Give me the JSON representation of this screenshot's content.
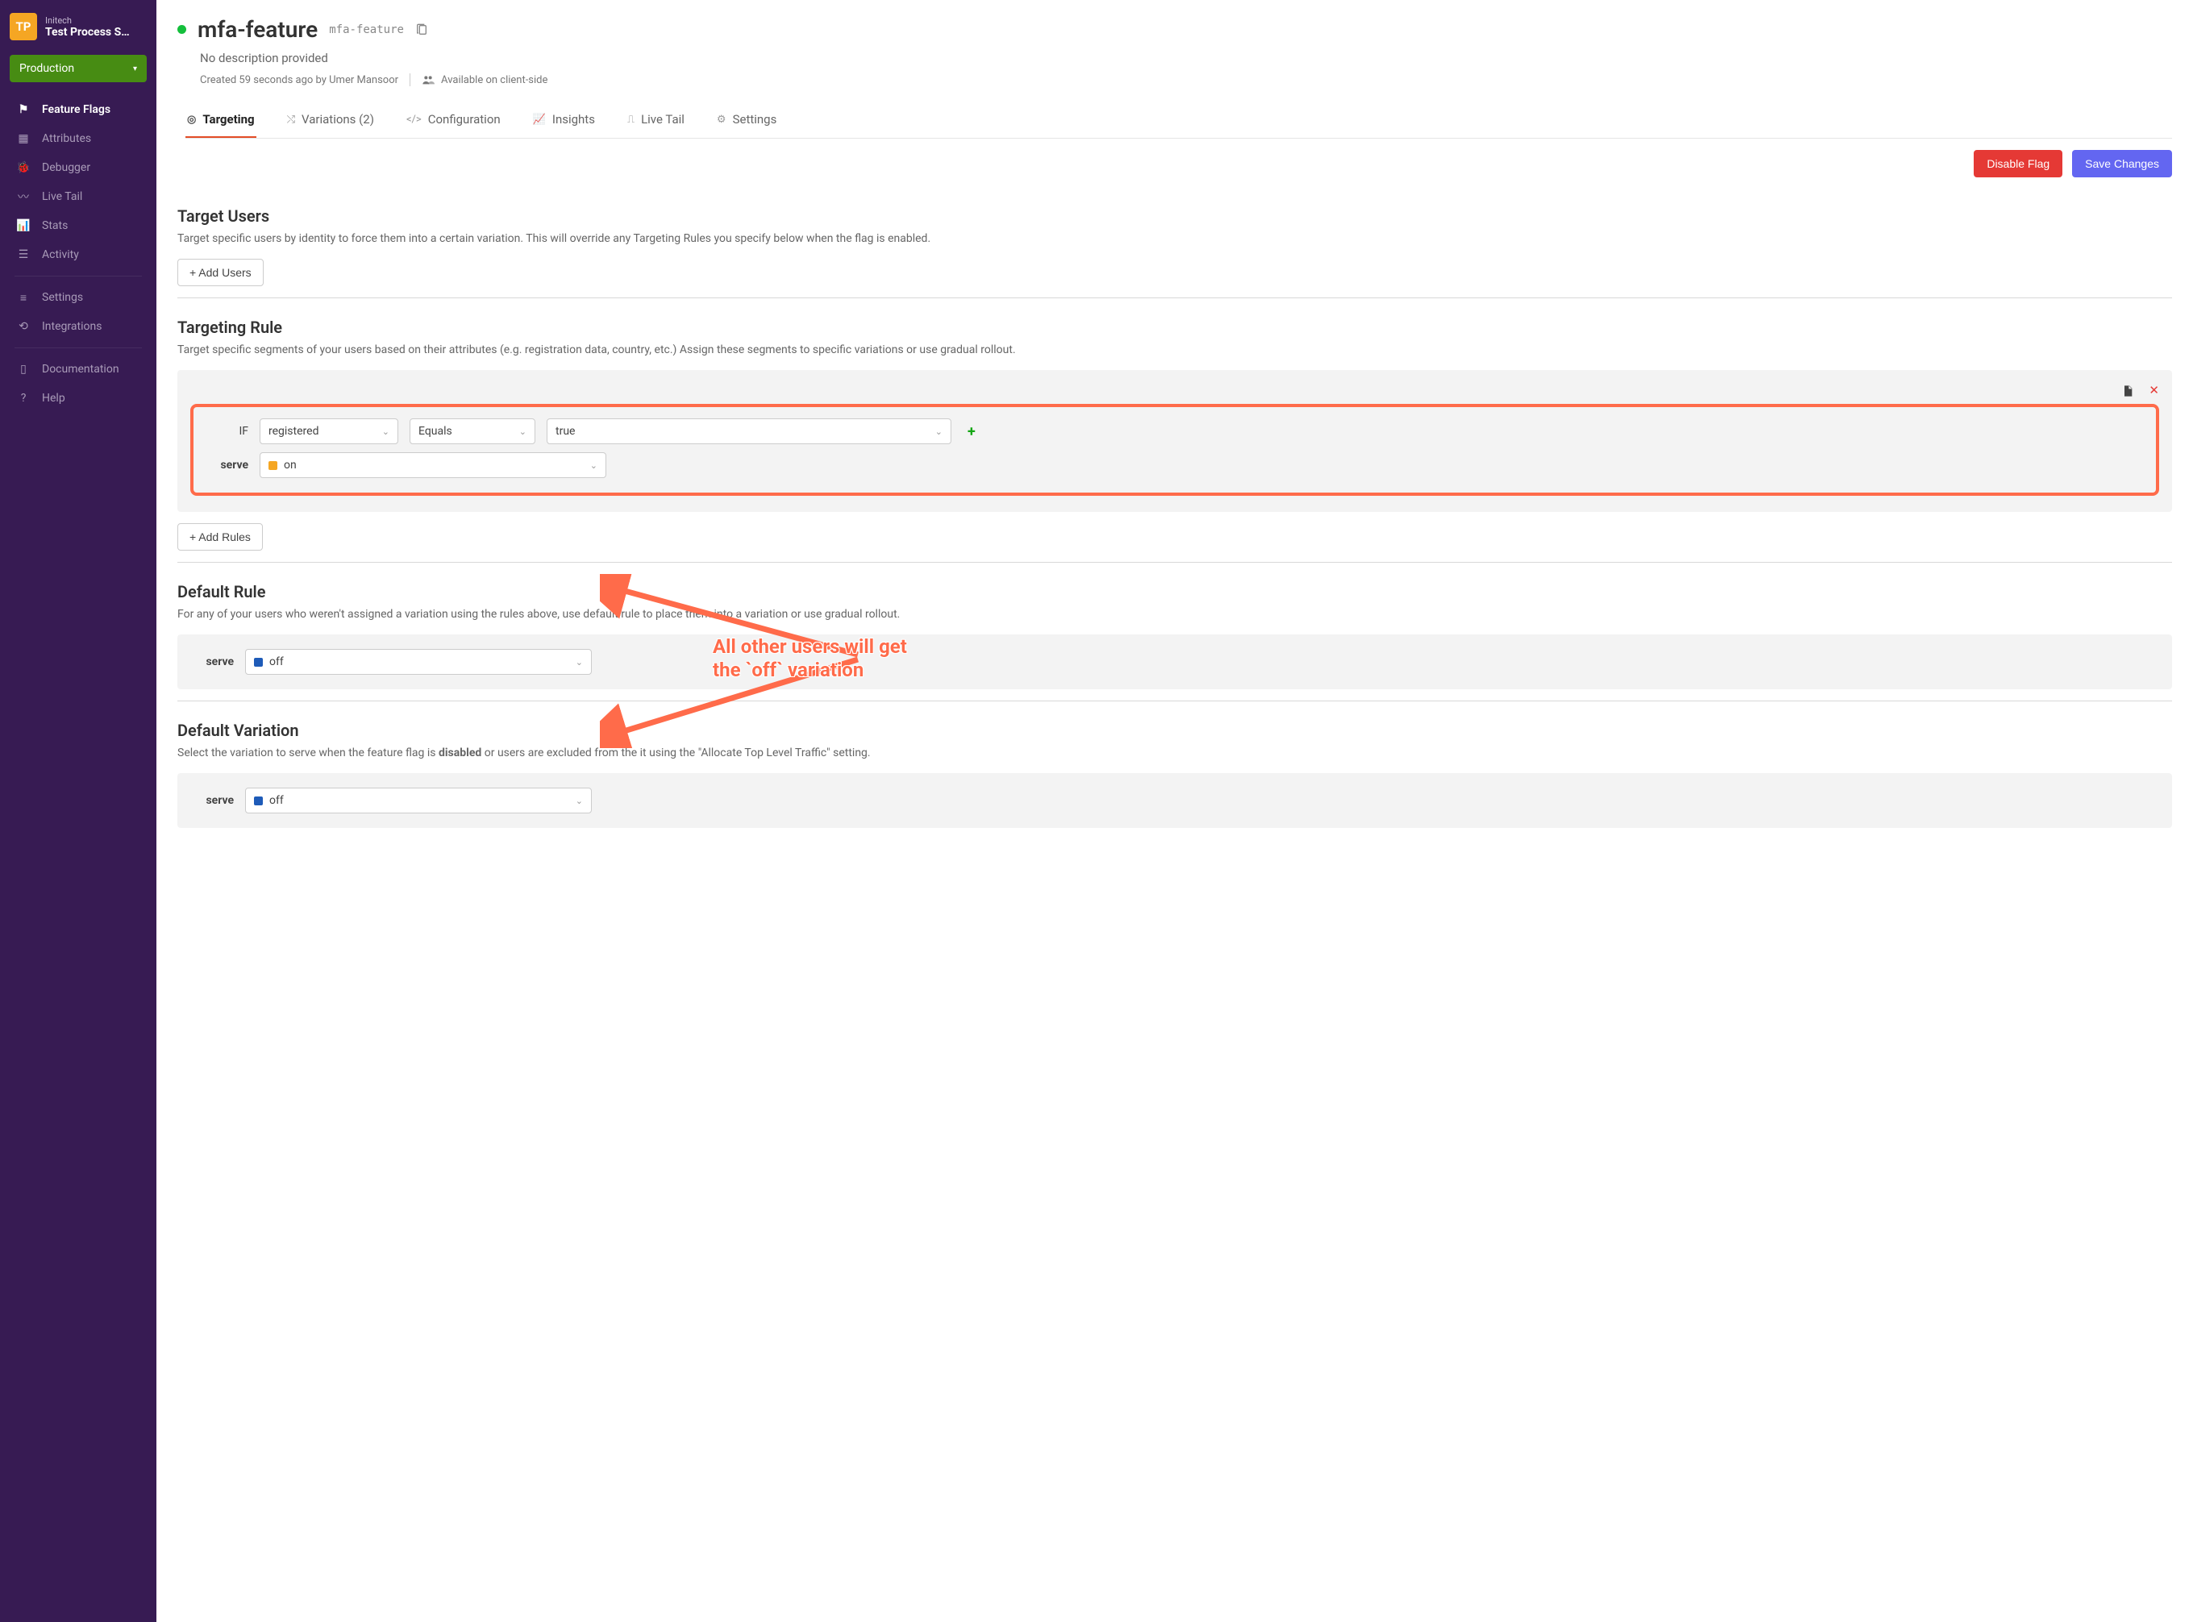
{
  "org": {
    "avatar": "TP",
    "name": "Initech",
    "project": "Test Process S…"
  },
  "environment": "Production",
  "sidebar": {
    "items": [
      {
        "icon": "flag",
        "label": "Feature Flags",
        "active": true
      },
      {
        "icon": "attrs",
        "label": "Attributes"
      },
      {
        "icon": "bug",
        "label": "Debugger"
      },
      {
        "icon": "wave",
        "label": "Live Tail"
      },
      {
        "icon": "stats",
        "label": "Stats"
      },
      {
        "icon": "list",
        "label": "Activity"
      }
    ],
    "secondary": [
      {
        "icon": "sliders",
        "label": "Settings"
      },
      {
        "icon": "plug",
        "label": "Integrations"
      }
    ],
    "footer": [
      {
        "icon": "book",
        "label": "Documentation"
      },
      {
        "icon": "help",
        "label": "Help"
      }
    ]
  },
  "flag": {
    "title": "mfa-feature",
    "key": "mfa-feature",
    "description": "No description provided",
    "created": "Created 59 seconds ago by Umer Mansoor",
    "availability": "Available on client-side"
  },
  "tabs": [
    {
      "icon": "target",
      "label": "Targeting",
      "active": true
    },
    {
      "icon": "shuffle",
      "label": "Variations (2)"
    },
    {
      "icon": "code",
      "label": "Configuration"
    },
    {
      "icon": "chart",
      "label": "Insights"
    },
    {
      "icon": "signal",
      "label": "Live Tail"
    },
    {
      "icon": "gear",
      "label": "Settings"
    }
  ],
  "actions": {
    "disable": "Disable Flag",
    "save": "Save Changes"
  },
  "sections": {
    "target_users": {
      "title": "Target Users",
      "desc": "Target specific users by identity to force them into a certain variation. This will override any Targeting Rules you specify below when the flag is enabled.",
      "add_btn": "+ Add Users"
    },
    "targeting_rule": {
      "title": "Targeting Rule",
      "desc": "Target specific segments of your users based on their attributes (e.g. registration data, country, etc.) Assign these segments to specific variations or use gradual rollout.",
      "if_label": "IF",
      "serve_label": "serve",
      "attr": "registered",
      "op": "Equals",
      "val": "true",
      "serve": "on",
      "add_btn": "+ Add Rules"
    },
    "default_rule": {
      "title": "Default Rule",
      "desc": "For any of your users who weren't assigned a variation using the rules above, use default rule to place them into a variation or use gradual rollout.",
      "serve_label": "serve",
      "serve": "off"
    },
    "default_variation": {
      "title": "Default Variation",
      "desc_pre": "Select the variation to serve when the feature flag is ",
      "desc_bold": "disabled",
      "desc_post": " or users are excluded from the it using the \"Allocate Top Level Traffic\" setting.",
      "serve_label": "serve",
      "serve": "off"
    }
  },
  "annotation": {
    "line1": "All other users will get",
    "line2": "the `off` variation"
  }
}
